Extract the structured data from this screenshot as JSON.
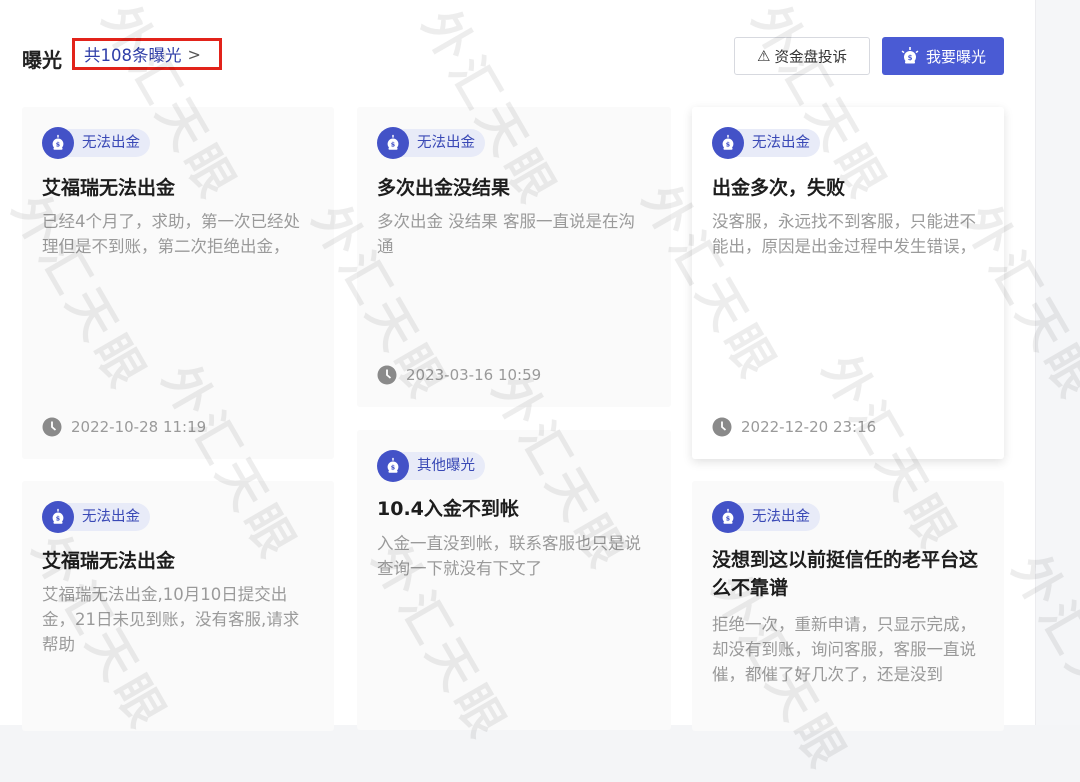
{
  "header": {
    "title": "曝光",
    "count_link": "共108条曝光",
    "complaint_button": "资金盘投诉",
    "expose_button": "我要曝光"
  },
  "cards": [
    {
      "tag": "无法出金",
      "title": "艾福瑞无法出金",
      "desc": "已经4个月了，求助，第一次已经处理但是不到账，第二次拒绝出金，",
      "time": "2022-10-28 11:19"
    },
    {
      "tag": "无法出金",
      "title": "多次出金没结果",
      "desc": "多次出金  没结果  客服一直说是在沟通",
      "time": "2023-03-16 10:59"
    },
    {
      "tag": "无法出金",
      "title": "出金多次，失败",
      "desc": "没客服，永远找不到客服，只能进不能出，原因是出金过程中发生错误，",
      "time": "2022-12-20 23:16"
    },
    {
      "tag": "无法出金",
      "title": "艾福瑞无法出金",
      "desc": "艾福瑞无法出金,10月10日提交出金，21日未见到账，没有客服,请求帮助",
      "time": ""
    },
    {
      "tag": "其他曝光",
      "title": "10.4入金不到帐",
      "desc": "入金一直没到帐，联系客服也只是说查询一下就没有下文了",
      "time": ""
    },
    {
      "tag": "无法出金",
      "title": "没想到这以前挺信任的老平台这么不靠谱",
      "desc": "拒绝一次，重新申请，只显示完成，却没有到账，询问客服，客服一直说催，都催了好几次了，还是没到",
      "time": ""
    }
  ],
  "watermark": "外汇天眼",
  "colors": {
    "accent": "#4a5bd4",
    "badge": "#4352c7",
    "tag_bg": "#e8ebf8",
    "highlight_border": "#e2231a"
  }
}
